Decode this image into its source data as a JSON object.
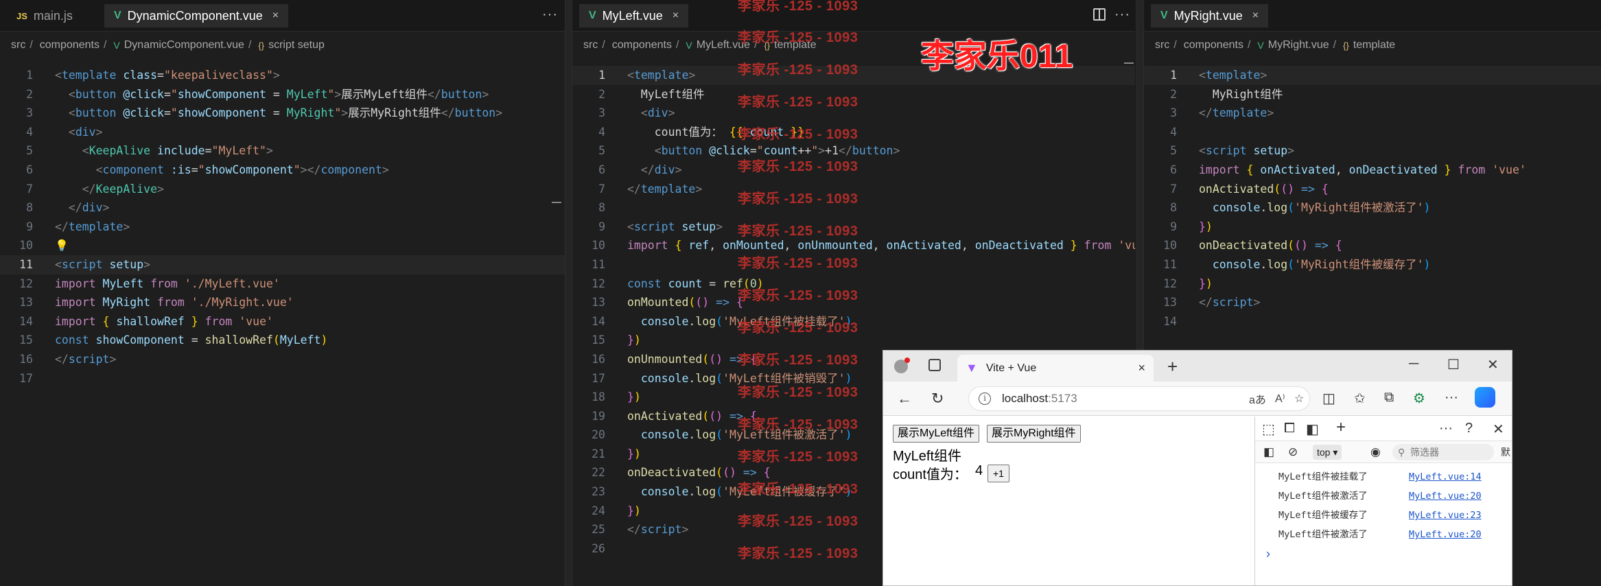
{
  "editor": {
    "pane1": {
      "tabs": [
        {
          "icon": "JS",
          "label": "main.js",
          "active": false
        },
        {
          "icon": "V",
          "label": "DynamicComponent.vue",
          "active": true,
          "close": "×"
        }
      ],
      "more": "···",
      "breadcrumb": [
        "src",
        "components",
        "DynamicComponent.vue",
        "script setup"
      ],
      "current_line": 11
    },
    "pane2": {
      "tabs": [
        {
          "icon": "V",
          "label": "MyLeft.vue",
          "active": true,
          "close": "×"
        }
      ],
      "more": "···",
      "breadcrumb": [
        "src",
        "components",
        "MyLeft.vue",
        "template"
      ],
      "current_line": 1
    },
    "pane3": {
      "tabs": [
        {
          "icon": "V",
          "label": "MyRight.vue",
          "active": true,
          "close": "×"
        }
      ],
      "breadcrumb": [
        "src",
        "components",
        "MyRight.vue",
        "template"
      ],
      "current_line": 1
    },
    "sep": "/",
    "vue_glyph": "V",
    "scope_glyph": "{}"
  },
  "watermark": {
    "repeat_text": "李家乐 -125 - 1093",
    "big_text": "李家乐011"
  },
  "browser": {
    "tab_title": "Vite + Vue",
    "tab_close": "×",
    "new_tab": "+",
    "url_host": "localhost",
    "url_port": ":5173",
    "page": {
      "button_left": "展示MyLeft组件",
      "button_right": "展示MyRight组件",
      "component_text": "MyLeft组件",
      "count_label": "count值为：",
      "count_value": "4",
      "increment_button": "+1"
    },
    "devtools": {
      "context": "top",
      "filter_placeholder": "筛选器",
      "cut_off": "默",
      "logs": [
        {
          "message": "MyLeft组件被挂载了",
          "source": "MyLeft.vue:14"
        },
        {
          "message": "MyLeft组件被激活了",
          "source": "MyLeft.vue:20"
        },
        {
          "message": "MyLeft组件被缓存了",
          "source": "MyLeft.vue:23"
        },
        {
          "message": "MyLeft组件被激活了",
          "source": "MyLeft.vue:20"
        }
      ],
      "prompt": "›"
    }
  }
}
